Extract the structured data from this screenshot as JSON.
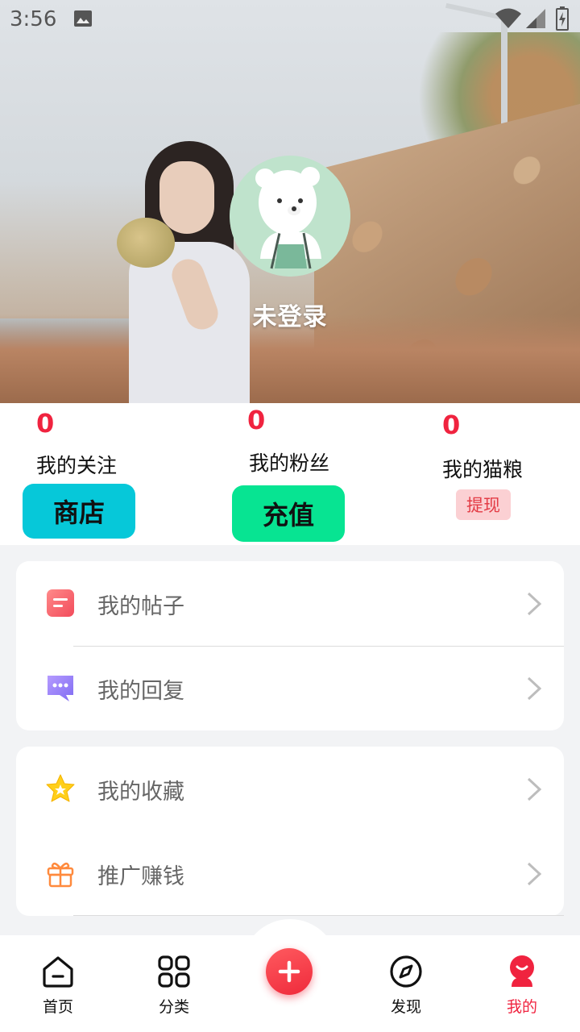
{
  "status_bar": {
    "time": "3:56",
    "icons": [
      "image-icon",
      "wifi-icon",
      "signal-icon",
      "battery-icon"
    ]
  },
  "profile": {
    "username": "未登录",
    "avatar": "bear-avatar"
  },
  "stats": {
    "following": {
      "count": "0",
      "label": "我的关注"
    },
    "fans": {
      "count": "0",
      "label": "我的粉丝"
    },
    "cat_food": {
      "count": "0",
      "label": "我的猫粮"
    }
  },
  "actions": {
    "shop_label": "商店",
    "recharge_label": "充值",
    "withdraw_label": "提现"
  },
  "menu_groups": [
    {
      "items": [
        {
          "label": "我的帖子",
          "icon": "post-icon"
        },
        {
          "label": "我的回复",
          "icon": "chat-bubble-icon"
        }
      ]
    },
    {
      "items": [
        {
          "label": "我的收藏",
          "icon": "star-icon"
        },
        {
          "label": "推广赚钱",
          "icon": "gift-icon"
        }
      ]
    }
  ],
  "tabbar": [
    {
      "label": "首页",
      "icon": "home-icon"
    },
    {
      "label": "分类",
      "icon": "grid-icon"
    },
    {
      "label": "",
      "icon": "plus-icon"
    },
    {
      "label": "发现",
      "icon": "compass-icon"
    },
    {
      "label": "我的",
      "icon": "profile-icon",
      "active": true
    }
  ],
  "colors": {
    "accent": "#f0233f",
    "shop": "#06c8d9",
    "recharge": "#07e492",
    "withdraw_bg": "#fbd0d3",
    "withdraw_text": "#e33b45"
  }
}
